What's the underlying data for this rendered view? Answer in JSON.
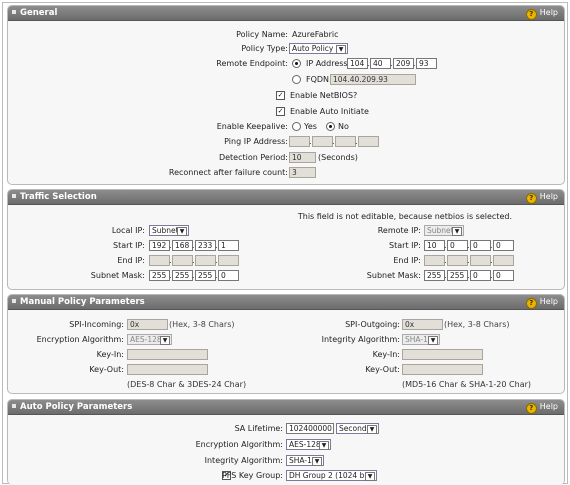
{
  "help_label": "Help",
  "general": {
    "title": "General",
    "policy_name_label": "Policy Name:",
    "policy_name_value": "AzureFabric",
    "policy_type_label": "Policy Type:",
    "policy_type_value": "Auto Policy",
    "remote_endpoint_label": "Remote Endpoint:",
    "ip_address_label": "IP Address:",
    "ip_octets": [
      "104",
      "40",
      "209",
      "93"
    ],
    "fqdn_label": "FQDN:",
    "fqdn_value": "104.40.209.93",
    "enable_netbios_label": "Enable NetBIOS?",
    "enable_auto_initiate_label": "Enable Auto Initiate",
    "enable_keepalive_label": "Enable Keepalive:",
    "yes_label": "Yes",
    "no_label": "No",
    "ping_ip_label": "Ping IP Address:",
    "detection_period_label": "Detection Period:",
    "detection_period_value": "10",
    "seconds_label": "(Seconds)",
    "reconnect_label": "Reconnect after failure count:",
    "reconnect_value": "3"
  },
  "traffic": {
    "title": "Traffic Selection",
    "note": "This field is not editable, because netbios is selected.",
    "local_ip_label": "Local IP:",
    "local_ip_type": "Subnet",
    "remote_ip_label": "Remote IP:",
    "remote_ip_type": "Subnet",
    "start_ip_label": "Start IP:",
    "end_ip_label": "End IP:",
    "subnet_mask_label": "Subnet Mask:",
    "local_start": [
      "192",
      "168",
      "233",
      "1"
    ],
    "local_mask": [
      "255",
      "255",
      "255",
      "0"
    ],
    "remote_start": [
      "10",
      "0",
      "0",
      "0"
    ],
    "remote_mask": [
      "255",
      "255",
      "0",
      "0"
    ]
  },
  "manual": {
    "title": "Manual Policy Parameters",
    "spi_in_label": "SPI-Incoming:",
    "spi_in_value": "0x",
    "spi_out_label": "SPI-Outgoing:",
    "spi_out_value": "0x",
    "hex_hint": "(Hex, 3-8 Chars)",
    "enc_label": "Encryption Algorithm:",
    "enc_value": "AES-128",
    "integ_label": "Integrity Algorithm:",
    "integ_value": "SHA-1",
    "key_in_label": "Key-In:",
    "key_out_label": "Key-Out:",
    "des_hint": "(DES-8 Char & 3DES-24 Char)",
    "md5_hint": "(MD5-16 Char & SHA-1-20 Char)"
  },
  "auto": {
    "title": "Auto Policy Parameters",
    "sa_lifetime_label": "SA Lifetime:",
    "sa_lifetime_value": "102400000",
    "sa_lifetime_unit": "Seconds",
    "enc_label": "Encryption Algorithm:",
    "enc_value": "AES-128",
    "integ_label": "Integrity Algorithm:",
    "integ_value": "SHA-1",
    "pfs_label": "PFS Key Group:",
    "pfs_value": "DH Group 2 (1024 bit)"
  }
}
